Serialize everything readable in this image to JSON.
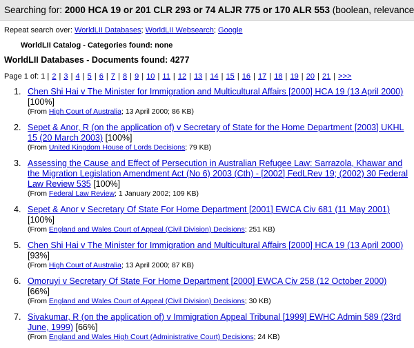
{
  "header": {
    "prefix": "Searching for: ",
    "query": "2000 HCA 19 or 201 CLR 293 or 74 ALJR 775 or 170 ALR 553",
    "suffix": " (boolean, relevance ranking)"
  },
  "repeat": {
    "label": "Repeat search over: ",
    "links": [
      "WorldLII Databases",
      "WorldLII Websearch",
      "Google"
    ],
    "sep": "; "
  },
  "catalog": {
    "text": "WorldLII Catalog - Categories found: none"
  },
  "databases": {
    "text": "WorldLII Databases - Documents found: 4277"
  },
  "pager": {
    "label": "Page 1 of: 1",
    "pages": [
      "2",
      "3",
      "4",
      "5",
      "6",
      "7",
      "8",
      "9",
      "10",
      "11",
      "12",
      "13",
      "14",
      "15",
      "16",
      "17",
      "18",
      "19",
      "20",
      "21"
    ],
    "next": ">>>"
  },
  "results": [
    {
      "num": "1.",
      "title": "Chen Shi Hai v The Minister for Immigration and Multicultural Affairs [2000] HCA 19 (13 April 2000)",
      "rank": "[100%]",
      "from": "(From ",
      "source": "High Court of Australia",
      "meta": "; 13 April 2000; 86 KB)"
    },
    {
      "num": "2.",
      "title": "Sepet & Anor, R (on the application of) v Secretary of State for the Home Department [2003] UKHL 15 (20 March 2003)",
      "rank": " [100%]",
      "from": "(From ",
      "source": "United Kingdom House of Lords Decisions",
      "meta": "; 79 KB)"
    },
    {
      "num": "3.",
      "title": "Assessing the Cause and Effect of Persecution in Australian Refugee Law: Sarrazola, Khawar and the Migration Legislation Amendment Act (No 6) 2003 (Cth) - [2002] FedLRev 19; (2002) 30 Federal Law Review 535",
      "rank": " [100%]",
      "from": "(From ",
      "source": "Federal Law Review",
      "meta": "; 1 January 2002; 109 KB)"
    },
    {
      "num": "4.",
      "title": "Sepet & Anor v Secretary Of State For Home Department [2001] EWCA Civ 681 (11 May 2001)",
      "rank": " [100%]",
      "from": "(From ",
      "source": "England and Wales Court of Appeal (Civil Division) Decisions",
      "meta": "; 251 KB)"
    },
    {
      "num": "5.",
      "title": "Chen Shi Hai v The Minister for Immigration and Multicultural Affairs [2000] HCA 19 (13 April 2000)",
      "rank": "[93%]",
      "from": "(From ",
      "source": "High Court of Australia",
      "meta": "; 13 April 2000; 87 KB)"
    },
    {
      "num": "6.",
      "title": "Omoruyi v Secretary Of State For Home Department [2000] EWCA Civ 258 (12 October 2000)",
      "rank": " [66%]",
      "from": "(From ",
      "source": "England and Wales Court of Appeal (Civil Division) Decisions",
      "meta": "; 30 KB)"
    },
    {
      "num": "7.",
      "title": "Sivakumar, R (on the application of) v Immigration Appeal Tribunal [1999] EWHC Admin 589 (23rd June, 1999)",
      "rank": " [66%]",
      "from": "(From ",
      "source": "England and Wales High Court (Administrative Court) Decisions",
      "meta": "; 24 KB)"
    }
  ]
}
